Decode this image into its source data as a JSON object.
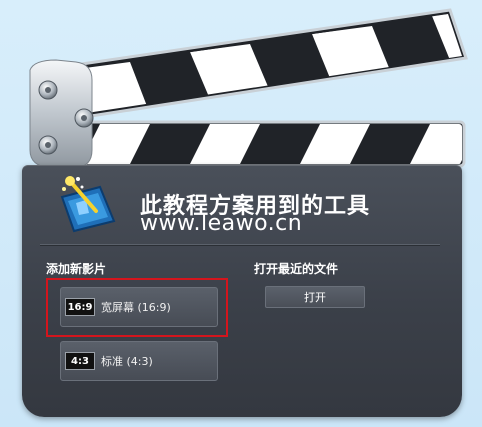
{
  "header": {
    "title": "此教程方案用到的工具",
    "subtitle": "www.leawo.cn"
  },
  "new_video": {
    "label": "添加新影片",
    "options": [
      {
        "badge": "16:9",
        "text": "宽屏幕 (16:9)",
        "highlighted": true
      },
      {
        "badge": "4:3",
        "text": "标准 (4:3)",
        "highlighted": false
      }
    ]
  },
  "recent": {
    "label": "打开最近的文件",
    "open_label": "打开"
  },
  "icons": {
    "logo": "video-wand-icon",
    "hinges": "screw-icon"
  },
  "colors": {
    "background": "#cfe8f8",
    "board": "#3f444d",
    "highlight": "#d4151d"
  }
}
